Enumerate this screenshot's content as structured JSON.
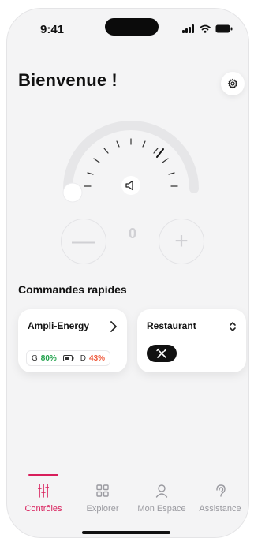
{
  "status": {
    "time": "9:41"
  },
  "header": {
    "title": "Bienvenue !"
  },
  "volume": {
    "value": "0",
    "decrease_symbol": "—",
    "increase_symbol": "+",
    "level": 0
  },
  "quick": {
    "title": "Commandes rapides",
    "ampli": {
      "title": "Ampli-Energy",
      "g_label": "G",
      "g_value": "80%",
      "d_label": "D",
      "d_value": "43%"
    },
    "restaurant": {
      "title": "Restaurant"
    }
  },
  "nav": {
    "items": [
      {
        "label": "Contrôles",
        "active": true
      },
      {
        "label": "Explorer"
      },
      {
        "label": "Mon Espace"
      },
      {
        "label": "Assistance"
      }
    ]
  },
  "colors": {
    "accent": "#d81e5b",
    "green": "#1fa14a",
    "red": "#ef5a3c"
  }
}
